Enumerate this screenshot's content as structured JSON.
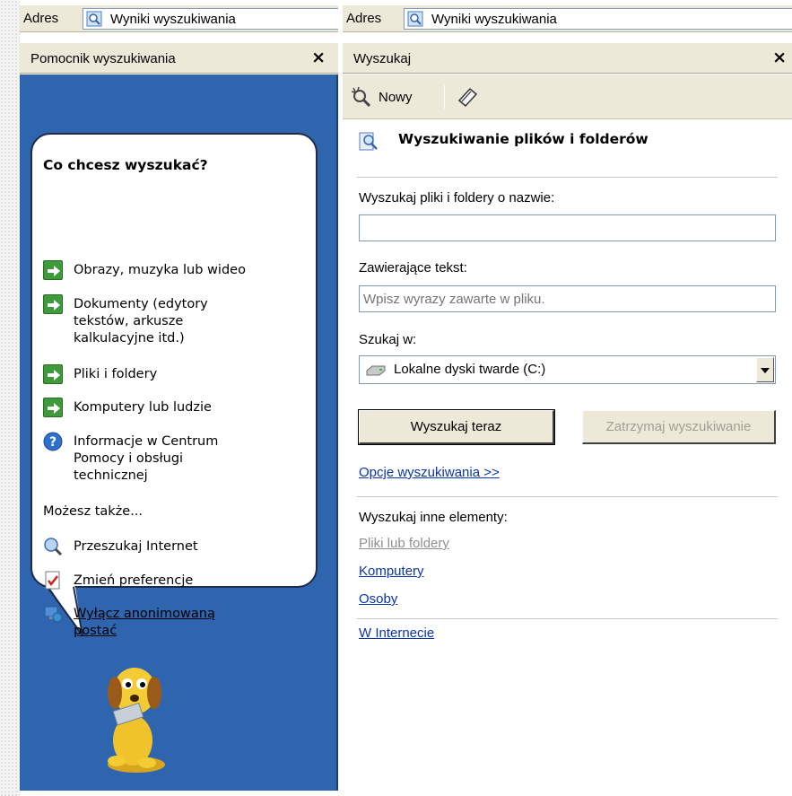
{
  "left": {
    "address_label": "Adres",
    "address_value": "Wyniki wyszukiwania",
    "pane_title": "Pomocnik wyszukiwania",
    "close_glyph": "×",
    "question": "Co chcesz wyszukać?",
    "options": [
      {
        "label": "Obrazy, muzyka lub wideo",
        "icon": "green-arrow-icon"
      },
      {
        "label": "Dokumenty (edytory tekstów, arkusze kalkulacyjne itd.)",
        "icon": "green-arrow-icon"
      },
      {
        "label": "Pliki i foldery",
        "icon": "green-arrow-icon"
      },
      {
        "label": "Komputery lub ludzie",
        "icon": "green-arrow-icon"
      },
      {
        "label": "Informacje w Centrum Pomocy i obsługi technicznej",
        "icon": "help-icon"
      }
    ],
    "also_heading": "Możesz także...",
    "also_items": [
      {
        "label": "Przeszukaj Internet",
        "icon": "internet-search-icon"
      },
      {
        "label": "Zmień preferencje",
        "icon": "preferences-icon"
      },
      {
        "label": "Wyłącz anonimowaną postać",
        "icon": "character-icon"
      }
    ]
  },
  "right": {
    "address_label": "Adres",
    "address_value": "Wyniki wyszukiwania",
    "pane_title": "Wyszukaj",
    "close_glyph": "×",
    "toolbar_new": "Nowy",
    "section_title": "Wyszukiwanie plików i folderów",
    "name_label": "Wyszukaj pliki i foldery o nazwie:",
    "name_value": "",
    "text_label": "Zawierające tekst:",
    "text_placeholder": "Wpisz wyrazy zawarte w pliku.",
    "lookin_label": "Szukaj w:",
    "lookin_value": "Lokalne dyski twarde (C:)",
    "search_button": "Wyszukaj teraz",
    "stop_button": "Zatrzymaj wyszukiwanie",
    "options_link": "Opcje wyszukiwania >>",
    "other_heading": "Wyszukaj inne elementy:",
    "other_links": [
      "Pliki lub foldery",
      "Komputery",
      "Osoby"
    ],
    "internet_link": "W Internecie"
  }
}
